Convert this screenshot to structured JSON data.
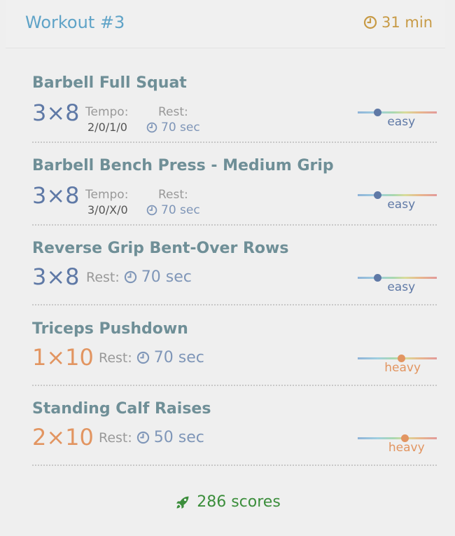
{
  "header": {
    "title": "Workout #3",
    "duration": "31 min"
  },
  "exercises": [
    {
      "name": "Barbell Full Squat",
      "sets": "3×8",
      "tempo_label": "Tempo:",
      "tempo": "2/0/1/0",
      "rest_label": "Rest:",
      "rest": "70 sec",
      "intensity": "easy",
      "intensity_level": 0.25
    },
    {
      "name": "Barbell Bench Press - Medium Grip",
      "sets": "3×8",
      "tempo_label": "Tempo:",
      "tempo": "3/0/X/0",
      "rest_label": "Rest:",
      "rest": "70 sec",
      "intensity": "easy",
      "intensity_level": 0.25
    },
    {
      "name": "Reverse Grip Bent-Over Rows",
      "sets": "3×8",
      "rest_label": "Rest:",
      "rest": "70 sec",
      "intensity": "easy",
      "intensity_level": 0.25
    },
    {
      "name": "Triceps Pushdown",
      "sets": "1×10",
      "rest_label": "Rest:",
      "rest": "70 sec",
      "intensity": "heavy",
      "intensity_level": 0.55
    },
    {
      "name": "Standing Calf Raises",
      "sets": "2×10",
      "rest_label": "Rest:",
      "rest": "50 sec",
      "intensity": "heavy",
      "intensity_level": 0.6
    }
  ],
  "footer": {
    "scores": "286 scores"
  },
  "colors": {
    "title": "#5fa3c7",
    "duration": "#c79a45",
    "easy": "#5f79a6",
    "heavy": "#e29561",
    "scores": "#3c8e3c"
  },
  "icons": {
    "clock": "clock-icon",
    "rocket": "rocket-icon"
  }
}
